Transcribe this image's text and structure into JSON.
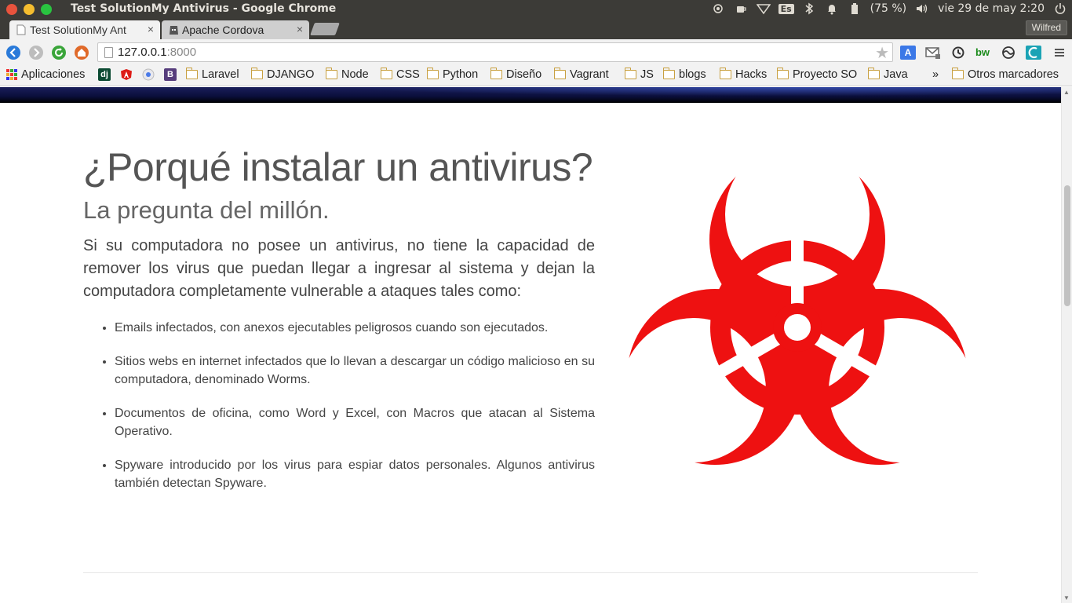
{
  "os": {
    "window_title": "Test SolutionMy Antivirus - Google Chrome",
    "keyboard": "Es",
    "battery": "(75 %)",
    "clock": "vie 29 de may  2:20"
  },
  "browser": {
    "tabs": [
      {
        "label": "Test SolutionMy Ant",
        "close": "×"
      },
      {
        "label": "Apache Cordova",
        "close": "×"
      }
    ],
    "profile": "Wilfred",
    "url_host": "127.0.0.1",
    "url_port": ":8000",
    "bookmarks": {
      "apps": "Aplicaciones",
      "folders": [
        "Laravel",
        "DJANGO",
        "Node",
        "CSS",
        "Python",
        "Diseño",
        "Vagrant",
        "JS",
        "blogs",
        "Hacks",
        "Proyecto SO",
        "Java"
      ],
      "overflow": "»",
      "other": "Otros marcadores"
    }
  },
  "page": {
    "title": "¿Porqué instalar un antivirus?",
    "subtitle": "La pregunta del millón.",
    "lead": "Si su computadora no posee un antivirus, no tiene la capacidad de remover los virus que puedan llegar a ingresar al sistema y dejan la computadora completamente vulnerable a ataques tales como:",
    "items": [
      "Emails infectados, con anexos ejecutables peligrosos cuando son ejecutados.",
      "Sitios webs en internet infectados que lo llevan a descargar un código malicioso en su computadora, denominado Worms.",
      "Documentos de oficina, como Word y Excel, con Macros que atacan al Sistema Operativo.",
      "Spyware introducido por los virus para espiar datos personales. Algunos antivirus también detectan Spyware."
    ]
  },
  "colors": {
    "biohazard": "#ee1111",
    "os_bar": "#3c3b37"
  }
}
